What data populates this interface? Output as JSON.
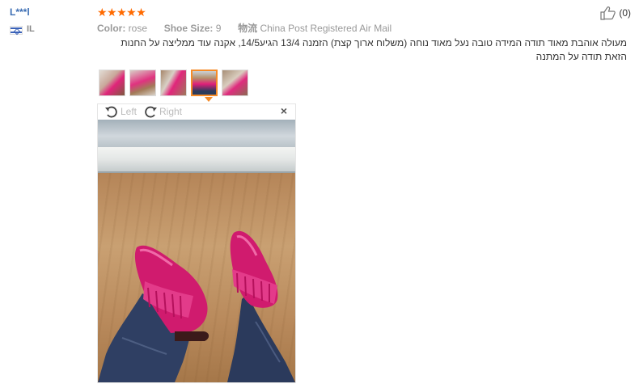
{
  "reviewer": {
    "name": "L***l",
    "country": "IL"
  },
  "rating": {
    "stars": 5,
    "stars_text": "★★★★★"
  },
  "attributes": {
    "color_label": "Color:",
    "color_value": "rose",
    "size_label": "Shoe Size:",
    "size_value": "9",
    "shipping_label": "物流",
    "shipping_value": "China Post Registered Air Mail"
  },
  "helpful": {
    "count": "(0)",
    "icon": "thumbs-up-icon"
  },
  "review_text": "מעולה אוהבת מאוד תודה המידה טובה נעל מאוד נוחה (משלוח ארוך קצת) הזמנה 13/4 הגיע14/5, אקנה עוד ממליצה על החנות הזאת תודה על המתנה",
  "thumbnails": {
    "count": 5,
    "active_index": 3
  },
  "viewer": {
    "rotate_left_label": "Left",
    "rotate_right_label": "Right",
    "close_label": "×"
  },
  "colors": {
    "star": "#ff6a00",
    "accent": "#f58b28",
    "link": "#3b6db3",
    "shoe": "#e0207a"
  }
}
